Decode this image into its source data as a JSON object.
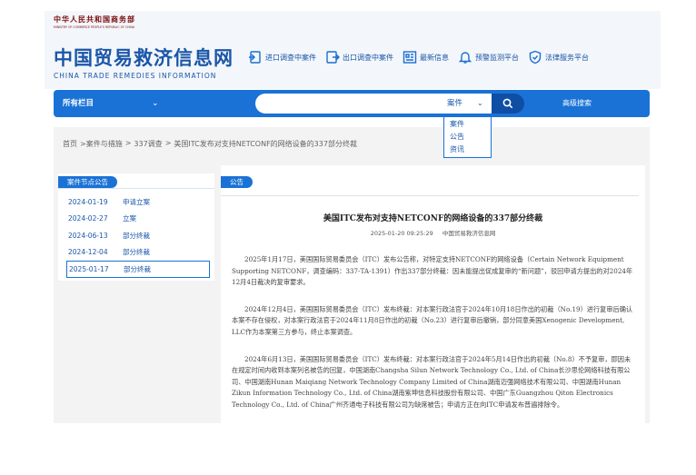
{
  "header": {
    "ministry_cn": "中华人民共和国商务部",
    "ministry_en": "MINISTRY OF COMMERCE PEOPLE'S REPUBLIC OF CHINA",
    "brand_cn": "中国贸易救济信息网",
    "brand_en": "CHINA TRADE REMEDIES INFORMATION",
    "quicklinks": [
      {
        "label": "进口调查中案件",
        "icon": "import-case-icon"
      },
      {
        "label": "出口调查中案件",
        "icon": "export-case-icon"
      },
      {
        "label": "最新信息",
        "icon": "news-icon"
      },
      {
        "label": "预警监测平台",
        "icon": "bell-icon"
      },
      {
        "label": "法律服务平台",
        "icon": "shield-check-icon"
      }
    ]
  },
  "nav": {
    "all_columns": "所有栏目",
    "search_placeholder": "",
    "search_type": "案件",
    "advanced_search": "高级搜索",
    "dropdown_options": [
      "案件",
      "公告",
      "资讯"
    ]
  },
  "breadcrumb": [
    "首页",
    ">案件与措施",
    ">",
    "337调查",
    ">",
    "美国ITC发布对支持NETCONF的网络设备的337部分终裁"
  ],
  "left_panel": {
    "title": "案件节点公告",
    "nodes": [
      {
        "date": "2024-01-19",
        "label": "申请立案"
      },
      {
        "date": "2024-02-27",
        "label": "立案"
      },
      {
        "date": "2024-06-13",
        "label": "部分终裁"
      },
      {
        "date": "2024-12-04",
        "label": "部分终裁"
      },
      {
        "date": "2025-01-17",
        "label": "部分终裁"
      }
    ]
  },
  "article": {
    "tab": "公告",
    "title": "美国ITC发布对支持NETCONF的网络设备的337部分终裁",
    "datetime": "2025-01-20 09:25:29",
    "source": "中国贸易救济信息网",
    "paragraphs": [
      "2025年1月17日，美国国际贸易委员会（ITC）发布公告称，对特定支持NETCONF的网络设备（Certain Network Equipment Supporting NETCONF，调查编码：337-TA-1391）作出337部分终裁：因未能提出促成复审的“新问题”，驳回申请方提出的对2024年12月4日裁决的复审要求。",
      "2024年12月4日，美国国际贸易委员会（ITC）发布终裁：对本案行政法官于2024年10月18日作出的初裁（No.19）进行复审后确认本案不存在侵权，对本案行政法官于2024年11月8日作出的初裁（No.23）进行复审后撤销，部分同意美国Xenogenic Development, LLC作为本案第三方参与，终止本案调查。",
      "2024年6月13日，美国国际贸易委员会（ITC）发布终裁：对本案行政法官于2024年5月14日作出的初裁（No.8）不予复审，即因未在规定时间内收到本案列名被告的回复，中国湖南Changsha Silun Network Technology Co., Ltd. of China长沙思伦网络科技有限公司、中国湖南Hunan Maiqiang Network Technology Company Limited of China湖南迈强网络技术有限公司、中国湖南Hunan Zikun Information Technology Co., Ltd. of China湖南紫坤信息科技股份有限公司、中国广东Guangzhou Qiton Electronics Technology Co., Ltd. of China广州齐通电子科技有限公司为缺席被告；申请方正在向ITC申请发布普遍排除令。"
    ]
  }
}
